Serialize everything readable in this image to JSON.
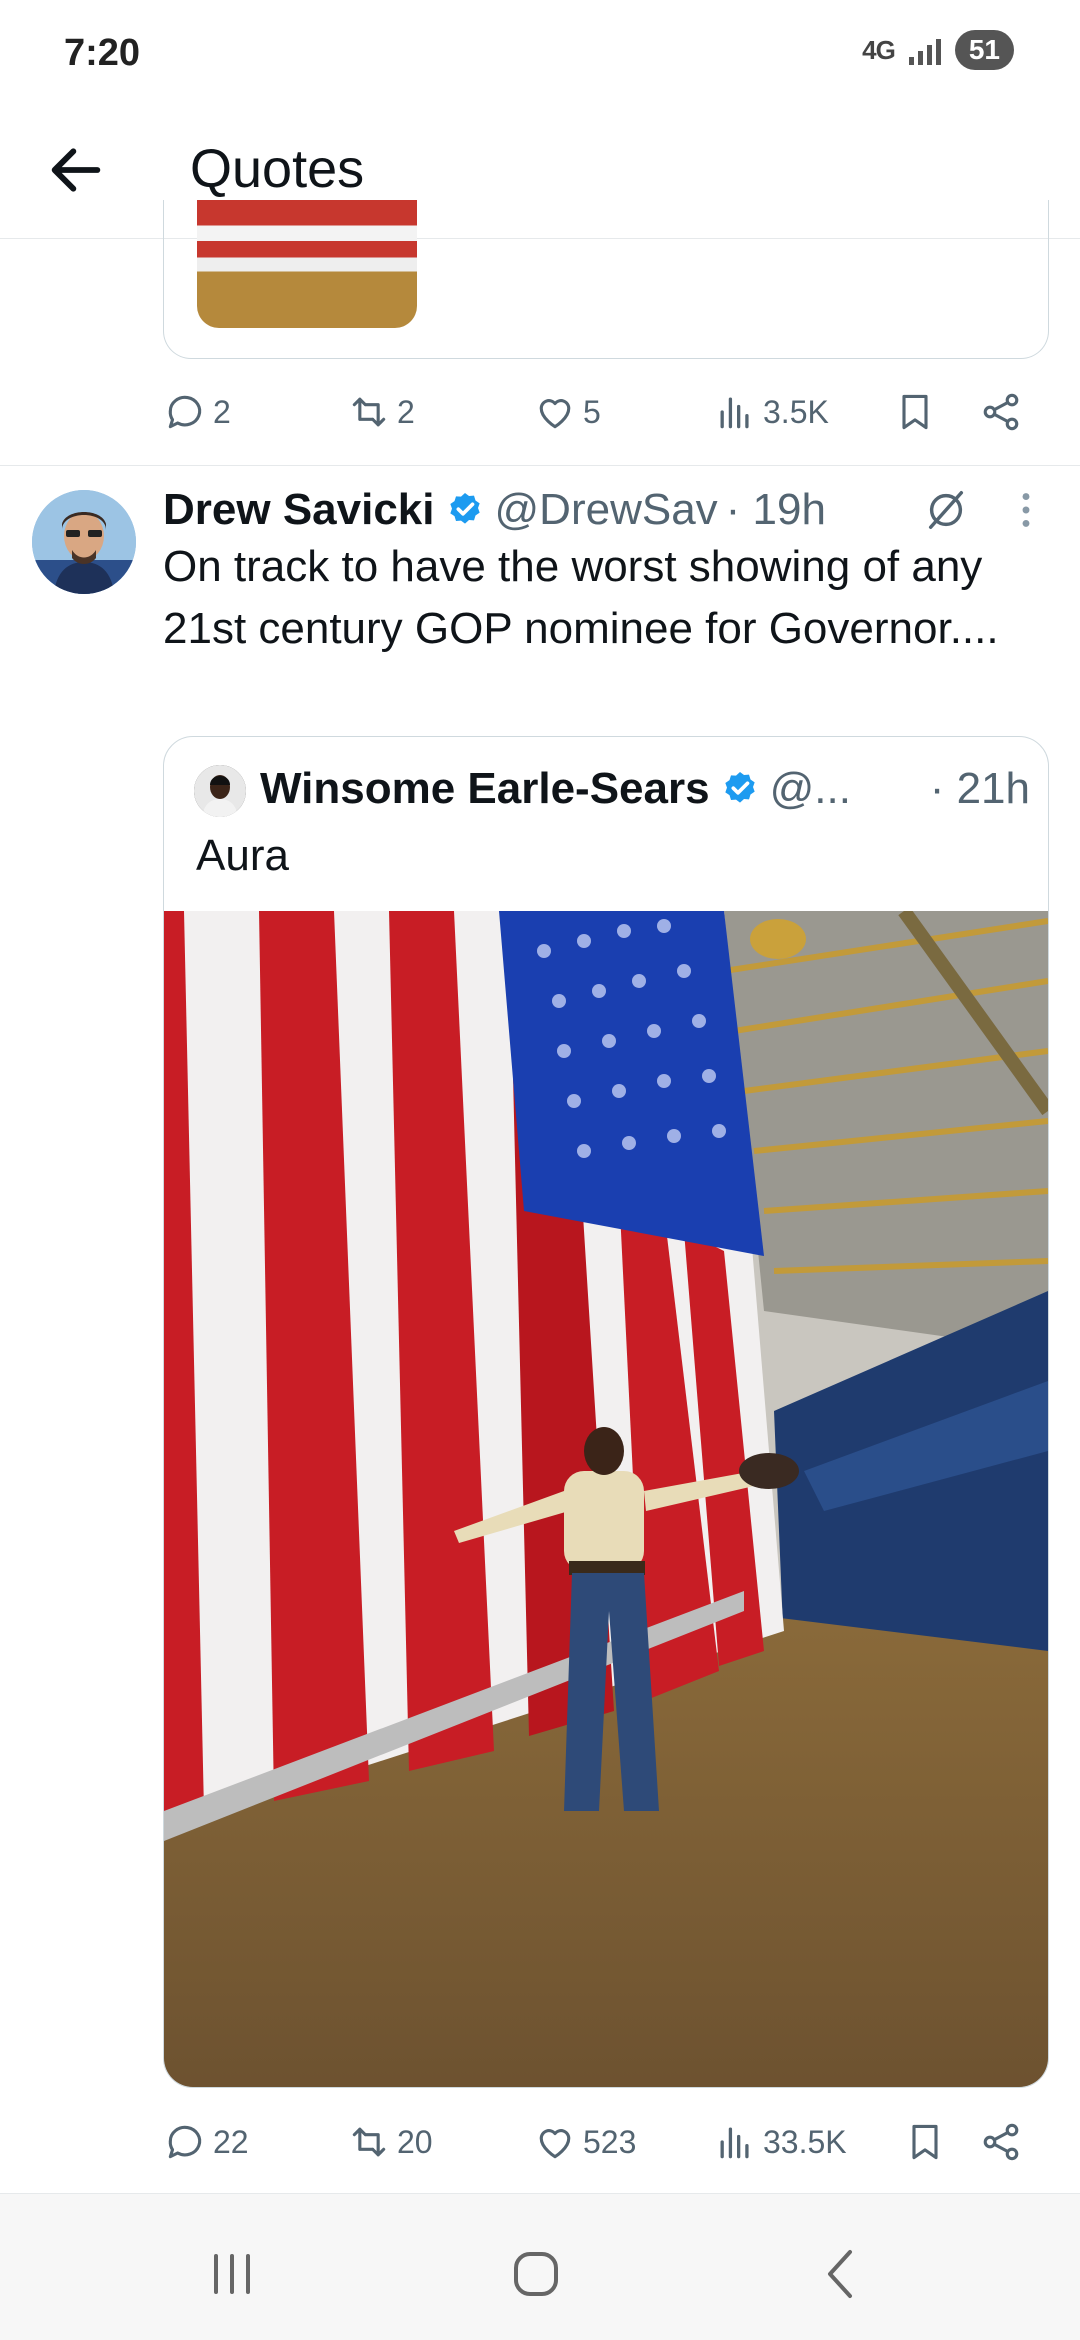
{
  "status": {
    "time": "7:20",
    "network": "4G",
    "battery": "51"
  },
  "header": {
    "title": "Quotes"
  },
  "prev_tweet": {
    "replies": "2",
    "reposts": "2",
    "likes": "5",
    "views": "3.5K"
  },
  "tweet": {
    "name": "Drew Savicki",
    "handle": "@DrewSav",
    "time": "· 19h",
    "text": "On track to have the worst showing of any 21st century GOP nominee for Governor....",
    "quote": {
      "name": "Winsome Earle-Sears",
      "handle": "@...",
      "time": "· 21h",
      "text": "Aura"
    },
    "replies": "22",
    "reposts": "20",
    "likes": "523",
    "views": "33.5K"
  },
  "colors": {
    "verified": "#1d9bf0",
    "icon": "#536471",
    "text": "#0f1419",
    "border": "#cfd9de"
  },
  "icons": [
    "back-arrow-icon",
    "reply-icon",
    "repost-icon",
    "like-icon",
    "views-icon",
    "bookmark-icon",
    "share-icon",
    "verified-icon",
    "grok-icon",
    "more-icon"
  ]
}
